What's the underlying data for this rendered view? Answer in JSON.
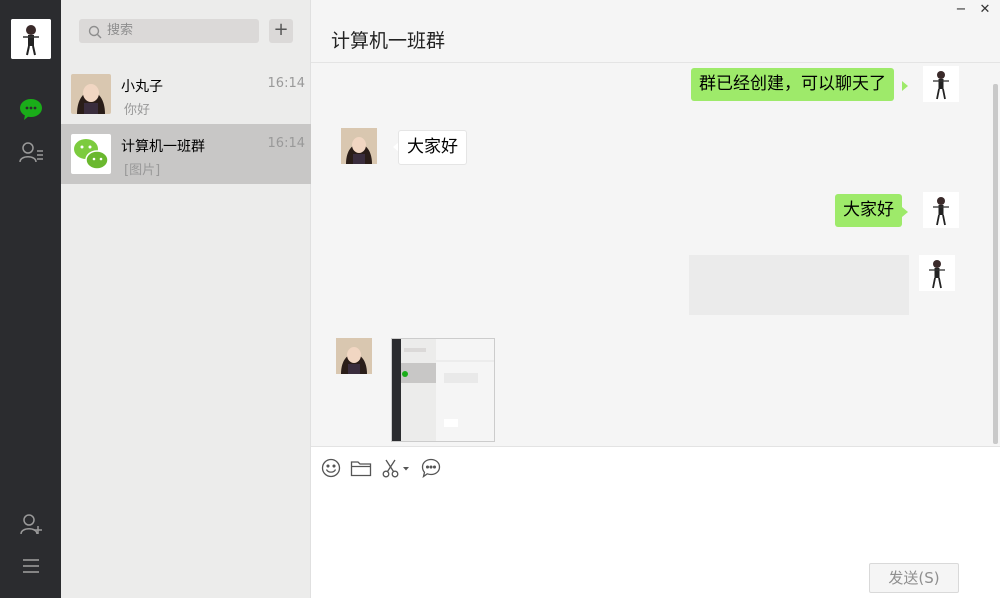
{
  "window": {
    "minimize_label": "−",
    "close_label": "✕"
  },
  "nav": {
    "items": [
      {
        "icon": "chat-icon"
      },
      {
        "icon": "contacts-icon"
      },
      {
        "icon": "add-contact-icon"
      },
      {
        "icon": "menu-icon"
      }
    ],
    "active_color": "#1aad19"
  },
  "search": {
    "placeholder": "搜索"
  },
  "add_button_label": "+",
  "conversations": [
    {
      "name": "小丸子",
      "time": "16:14",
      "preview": "你好",
      "selected": false
    },
    {
      "name": "计算机一班群",
      "time": "16:14",
      "preview": "[图片]",
      "selected": true
    }
  ],
  "chat": {
    "title": "计算机一班群",
    "messages": [
      {
        "from": "me",
        "text": "群已经创建，可以聊天了"
      },
      {
        "from": "other",
        "text": "大家好"
      },
      {
        "from": "me",
        "text": "大家好"
      },
      {
        "from": "me",
        "type": "loading-image"
      },
      {
        "from": "other",
        "type": "image"
      }
    ],
    "thumbnail_texts": {
      "header": "计算机一班群",
      "line1": "群已经创建，可以聊天了",
      "line2": "大家好"
    }
  },
  "composer": {
    "tools": [
      "emoji-icon",
      "folder-icon",
      "scissors-icon",
      "chat-bubble-icon"
    ],
    "send_label": "发送(S)"
  },
  "colors": {
    "nav_bg": "#2b2c2f",
    "list_bg": "#ececeb",
    "selected_bg": "#c8c7c6",
    "bubble_me": "#9eea6a",
    "bubble_other": "#ffffff"
  }
}
